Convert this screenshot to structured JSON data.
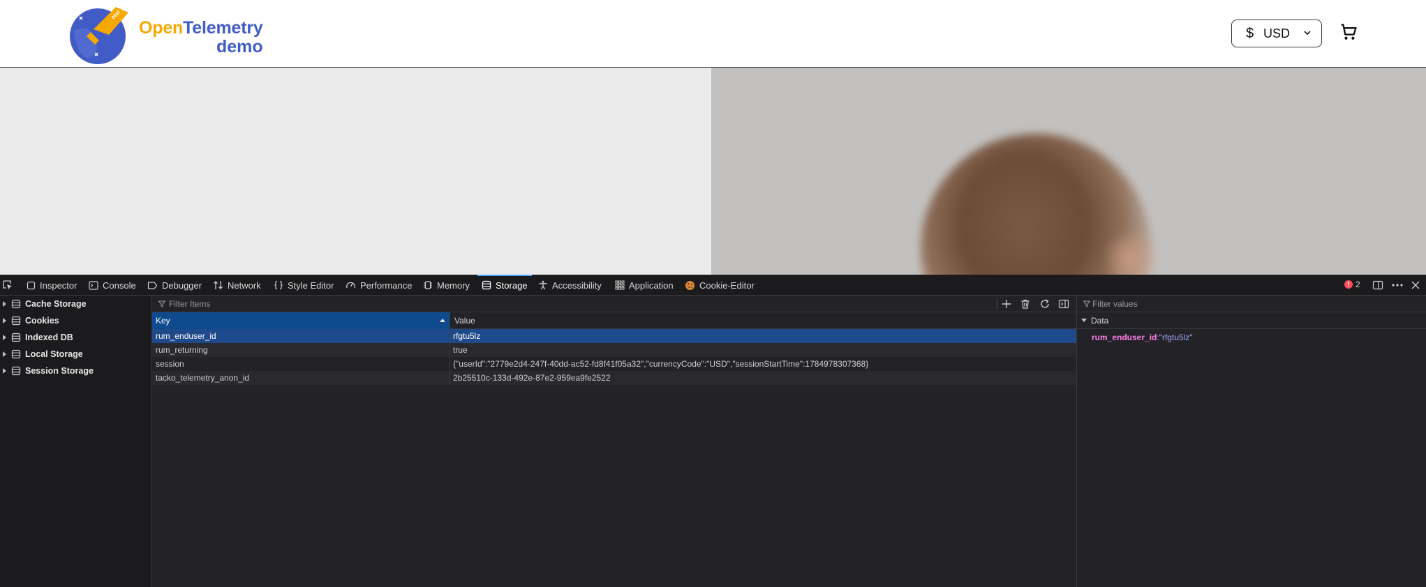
{
  "header": {
    "logo_word1": "Open",
    "logo_word2": "Telemetry",
    "logo_line2": "demo",
    "currency": {
      "symbol": "$",
      "code": "USD"
    },
    "cart_icon": "shopping-cart-icon"
  },
  "devtools": {
    "tabs": [
      {
        "label": "Inspector",
        "icon": "inspector-icon"
      },
      {
        "label": "Console",
        "icon": "console-icon"
      },
      {
        "label": "Debugger",
        "icon": "debugger-icon"
      },
      {
        "label": "Network",
        "icon": "network-icon"
      },
      {
        "label": "Style Editor",
        "icon": "braces-icon"
      },
      {
        "label": "Performance",
        "icon": "gauge-icon"
      },
      {
        "label": "Memory",
        "icon": "chip-icon"
      },
      {
        "label": "Storage",
        "icon": "storage-icon",
        "active": true
      },
      {
        "label": "Accessibility",
        "icon": "accessibility-icon"
      },
      {
        "label": "Application",
        "icon": "grid-icon"
      },
      {
        "label": "Cookie-Editor",
        "icon": "cookie-icon"
      }
    ],
    "error_count": "2",
    "sidebar": [
      {
        "label": "Cache Storage"
      },
      {
        "label": "Cookies"
      },
      {
        "label": "Indexed DB"
      },
      {
        "label": "Local Storage"
      },
      {
        "label": "Session Storage"
      }
    ],
    "filter_items_placeholder": "Filter Items",
    "filter_values_placeholder": "Filter values",
    "columns": {
      "key": "Key",
      "value": "Value"
    },
    "rows": [
      {
        "key": "rum_enduser_id",
        "value": "rfgtu5lz"
      },
      {
        "key": "rum_returning",
        "value": "true"
      },
      {
        "key": "session",
        "value": "{\"userId\":\"2779e2d4-247f-40dd-ac52-fd8f41f05a32\",\"currencyCode\":\"USD\",\"sessionStartTime\":1784978307368}"
      },
      {
        "key": "tacko_telemetry_anon_id",
        "value": "2b25510c-133d-492e-87e2-959ea9fe2522"
      }
    ],
    "detail": {
      "section": "Data",
      "entry_key": "rum_enduser_id",
      "entry_sep": ":",
      "entry_value": "\"rfgtu5lz\""
    }
  }
}
